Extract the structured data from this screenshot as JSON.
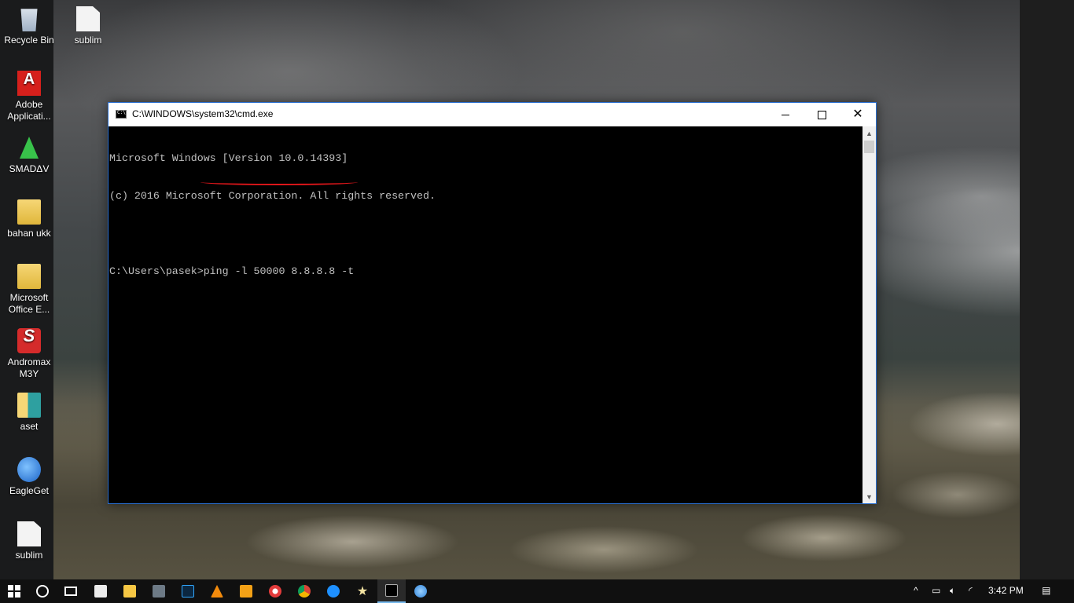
{
  "desktop": {
    "icons": [
      {
        "label": "Recycle Bin",
        "icon": "recycle-bin-icon"
      },
      {
        "label": "sublim",
        "icon": "file-icon"
      },
      {
        "label": "Adobe Applicati...",
        "icon": "adobe-icon"
      },
      {
        "label": "SMADΔV",
        "icon": "smadav-icon"
      },
      {
        "label": "bahan ukk",
        "icon": "folder-icon"
      },
      {
        "label": "Microsoft Office E...",
        "icon": "folder-icon"
      },
      {
        "label": "Andromax M3Y",
        "icon": "andromax-icon"
      },
      {
        "label": "aset",
        "icon": "folder-icon"
      },
      {
        "label": "EagleGet",
        "icon": "eagleget-icon"
      },
      {
        "label": "sublim",
        "icon": "file-icon"
      }
    ]
  },
  "window": {
    "title": "C:\\WINDOWS\\system32\\cmd.exe",
    "controls": {
      "minimize": "minimize",
      "maximize": "maximize",
      "close": "✕"
    }
  },
  "console": {
    "lines": [
      "Microsoft Windows [Version 10.0.14393]",
      "(c) 2016 Microsoft Corporation. All rights reserved.",
      "",
      "C:\\Users\\pasek>ping -l 50000 8.8.8.8 -t"
    ]
  },
  "taskbar": {
    "apps": [
      "start-icon",
      "search-icon",
      "task-view-icon",
      "store-icon",
      "file-explorer-icon",
      "media-icon",
      "photoshop-icon",
      "vlc-icon",
      "media-player-icon",
      "browser-icon",
      "chrome-icon",
      "edge-icon",
      "star-icon",
      "cmd-icon",
      "paint-icon"
    ],
    "tray": {
      "chevron": "^",
      "time": "3:42 PM"
    }
  }
}
